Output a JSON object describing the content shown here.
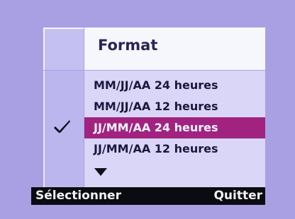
{
  "screen_title": "Format",
  "options": [
    {
      "label": "MM/JJ/AA 24 heures",
      "selected": false
    },
    {
      "label": "MM/JJ/AA 12 heures",
      "selected": false
    },
    {
      "label": "JJ/MM/AA 24 heures",
      "selected": true
    },
    {
      "label": "JJ/MM/AA 12 heures",
      "selected": false
    }
  ],
  "softkeys": {
    "left_label": "Sélectionner",
    "right_label": "Quitter"
  },
  "icons": {
    "check": "checkmark-icon",
    "more": "down-arrow-icon"
  },
  "colors": {
    "background": "#a9a0e3",
    "selection": "#a1237f",
    "softkey_bar": "#0b0b12",
    "title_bar": "#f6f6fd"
  }
}
